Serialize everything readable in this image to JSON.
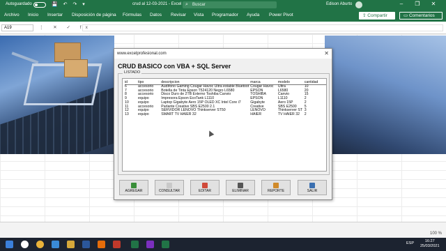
{
  "titlebar": {
    "autosave_label": "Autoguardado",
    "doc_title": "crud al 12-03-2021  -  Excel",
    "search_placeholder": "Buscar",
    "user_name": "Edison Aburto",
    "min_icon": "minimize-icon",
    "max_icon": "restore-icon",
    "close_icon": "close-icon"
  },
  "ribbon": {
    "tabs": [
      "Archivo",
      "Inicio",
      "Insertar",
      "Disposición de página",
      "Fórmulas",
      "Datos",
      "Revisar",
      "Vista",
      "Programador",
      "Ayuda",
      "Power Pivot"
    ],
    "share_label": "Compartir",
    "comments_label": "Comentarios"
  },
  "formula_bar": {
    "name_box": "A19",
    "fx_symbols": "⋮ ✕ ✓ fx",
    "value": ""
  },
  "dialog": {
    "title": "www.excelprofesional.com",
    "heading": "CRUD BASICO con VBA + SQL Server",
    "frame_label": "LISTADO",
    "columns": [
      "id",
      "tipo",
      "descripcion",
      "marca",
      "modelo",
      "cantidad"
    ],
    "rows": [
      [
        "6",
        "accesorio",
        "Audífono Gaming Cougar Havoc Ultra estable Bluetoot",
        "Cougar Havoc",
        "Ultra",
        "10"
      ],
      [
        "7",
        "accesorio",
        "Botella de Tinta Epson T524120 Negro L6580",
        "EPSON",
        "L6580",
        "20"
      ],
      [
        "8",
        "accesorio",
        "Disco Duro de 2TB Externo Toshiba Canvio",
        "TOSHIBA",
        "Canvio",
        "15"
      ],
      [
        "9",
        "equipo",
        "Impresora Epson EcoTank L1110",
        "EPSON",
        "L1110",
        "2"
      ],
      [
        "10",
        "equipo",
        "Laptop Gigabyte Aero 15P OLED XC Intel Core i7",
        "Gigabyte",
        "Aero 15P",
        "2"
      ],
      [
        "11",
        "accesorio",
        "Parlante Creative SBS E2500 2.1",
        "Creative",
        "SBS E2500",
        "5"
      ],
      [
        "12",
        "equipo",
        "SERVIDOR LENOVO Thinkserver ST50",
        "LENOVO",
        "Thinkserver ST",
        "3"
      ],
      [
        "13",
        "equipo",
        "SMART TV HAIER 32",
        "HAIER",
        "TV HAIER 32",
        "2"
      ]
    ],
    "buttons": [
      {
        "label": "AGREGAR",
        "icon": "add-icon",
        "color": "#3a8f3a"
      },
      {
        "label": "CONSULTAR",
        "icon": "search-icon",
        "color": "#c9c9c9"
      },
      {
        "label": "EDITAR",
        "icon": "edit-icon",
        "color": "#d04a3a"
      },
      {
        "label": "ELIMINAR",
        "icon": "delete-icon",
        "color": "#555555"
      },
      {
        "label": "REPORTE",
        "icon": "report-icon",
        "color": "#d08a2a"
      },
      {
        "label": "SALIR",
        "icon": "exit-icon",
        "color": "#3a6fb0"
      }
    ]
  },
  "statusbar": {
    "zoom": "100 %"
  },
  "taskbar": {
    "time": "16:27",
    "date": "25/03/2021",
    "lang": "ESP"
  },
  "colors": {
    "excel_green": "#217346",
    "taskbar": "#1c2330"
  }
}
